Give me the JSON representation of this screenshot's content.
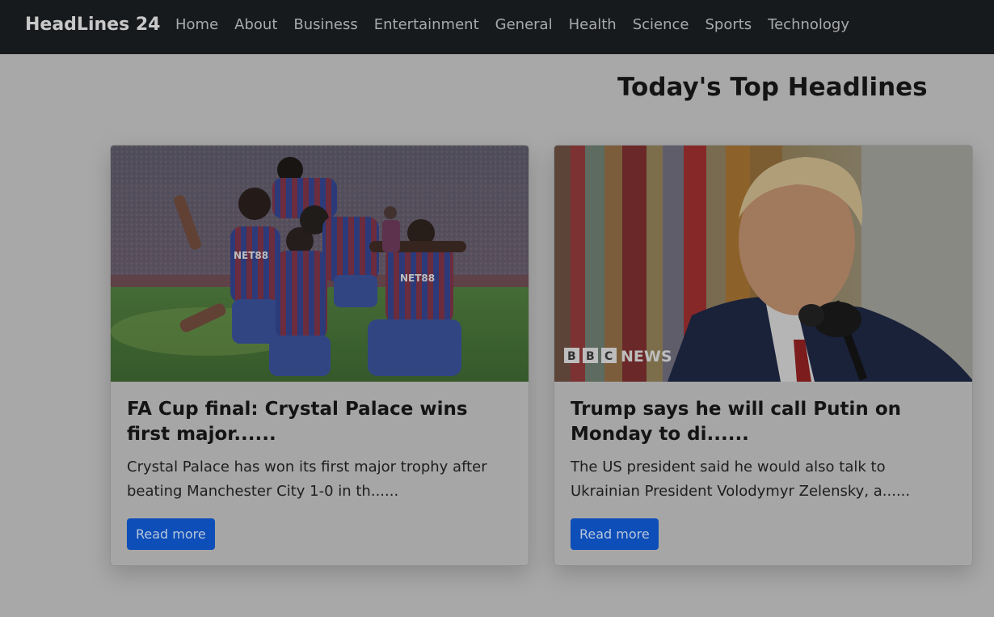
{
  "navbar": {
    "brand": "HeadLines 24",
    "links": [
      "Home",
      "About",
      "Business",
      "Entertainment",
      "General",
      "Health",
      "Science",
      "Sports",
      "Technology"
    ]
  },
  "main": {
    "title": "Today's Top Headlines",
    "cards": [
      {
        "title": "FA Cup final: Crystal Palace wins first major......",
        "description": "Crystal Palace has won its first major trophy after beating Manchester City 1-0 in th......",
        "button": "Read more",
        "image": {
          "alt": "football-celebration-photo",
          "kit_text": "NET88"
        }
      },
      {
        "title": "Trump says he will call Putin on Monday to di......",
        "description": "The US president said he would also talk to Ukrainian President Volodymyr Zelensky, a......",
        "button": "Read more",
        "image": {
          "alt": "press-conference-photo",
          "watermark": "NEWS",
          "watermark_letters": [
            "B",
            "B",
            "C"
          ]
        }
      }
    ]
  },
  "colors": {
    "navbar": "#171a1d",
    "page_background": "#a8a8a8",
    "button": "#0d4eb8"
  }
}
